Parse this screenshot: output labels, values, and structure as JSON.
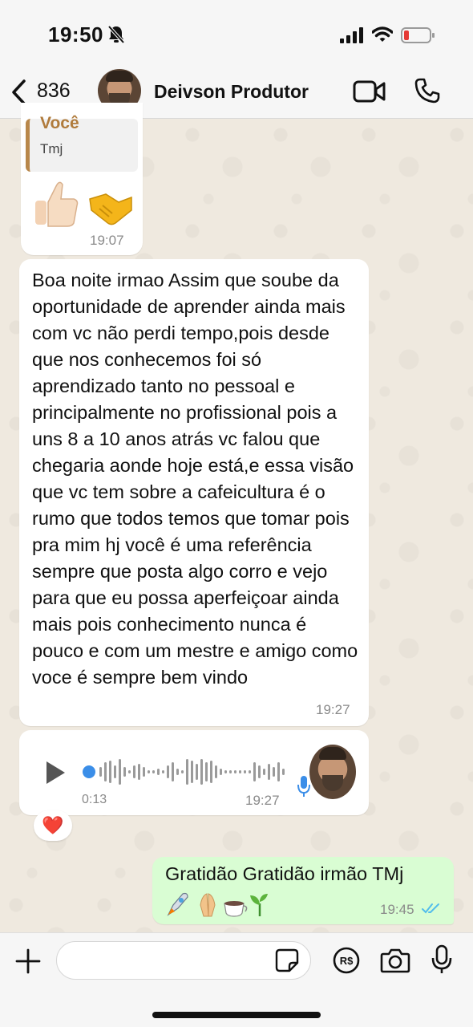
{
  "status_bar": {
    "time": "19:50"
  },
  "header": {
    "back_count": "836",
    "contact_name": "Deivson Produtor"
  },
  "messages": {
    "quoted": {
      "author": "Você",
      "text": "Tmj",
      "emojis": "👍🤝",
      "time": "19:07"
    },
    "long": {
      "text": "Boa noite irmao Assim que soube da oportunidade de aprender ainda mais com vc não perdi tempo,pois desde que nos conhecemos foi só aprendizado tanto no pessoal e principalmente no profissional pois a uns 8 a 10 anos atrás  vc falou que chegaria aonde hoje  está,e essa visão que vc tem sobre a cafeicultura é o rumo que todos temos que tomar  pois pra mim hj você é uma referência sempre que posta algo corro e vejo para que eu possa aperfeiçoar ainda mais pois conhecimento nunca é pouco e com um mestre e amigo como voce é sempre bem vindo",
      "time": "19:27"
    },
    "audio": {
      "duration": "0:13",
      "time": "19:27",
      "reaction": "❤️"
    },
    "outgoing": {
      "text": "Gratidão Gratidão irmão TMj",
      "emojis": "🚀🙏☕🌱",
      "time": "19:45"
    }
  },
  "icons": [
    "bell-slash-icon",
    "signal-icon",
    "wifi-icon",
    "battery-icon",
    "back-chevron-icon",
    "video-call-icon",
    "phone-icon",
    "play-icon",
    "microphone-icon",
    "plus-icon",
    "sticker-icon",
    "pix-icon",
    "camera-icon",
    "double-check-icon"
  ],
  "colors": {
    "outgoing_bubble": "#d9fdd3",
    "read_ticks": "#53bdeb",
    "battery_low": "#e53935",
    "quote_bar": "#b8874a"
  }
}
